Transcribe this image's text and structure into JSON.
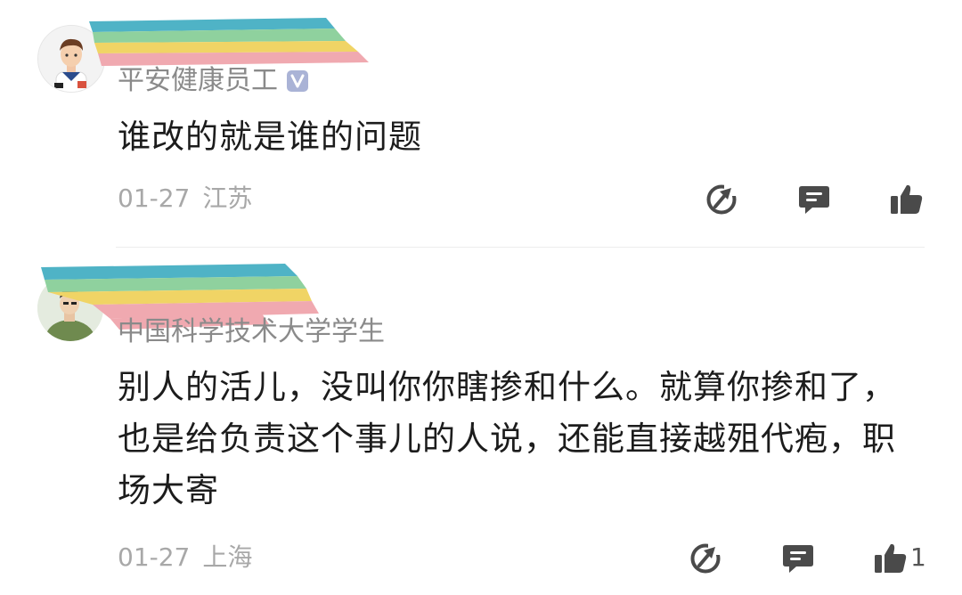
{
  "comments": [
    {
      "username": "平安健康员工",
      "verified": true,
      "content": "谁改的就是谁的问题",
      "date": "01-27",
      "location": "江苏",
      "like_count": ""
    },
    {
      "username": "中国科学技术大学学生",
      "verified": false,
      "content": "别人的活儿，没叫你你瞎掺和什么。就算你掺和了，也是给负责这个事儿的人说，还能直接越殂代疱，职场大寄",
      "date": "01-27",
      "location": "上海",
      "like_count": "1"
    }
  ],
  "icons": {
    "share": "share-icon",
    "reply": "reply-icon",
    "like": "thumbs-up-icon",
    "verified": "verified-v-icon"
  },
  "colors": {
    "meta_text": "#a8a8a8",
    "icon": "#4a4a4a",
    "verified_badge": "#aab3d6",
    "redaction": [
      "#4fb3c6",
      "#8fd19e",
      "#f0d465",
      "#f0a9b0"
    ]
  }
}
